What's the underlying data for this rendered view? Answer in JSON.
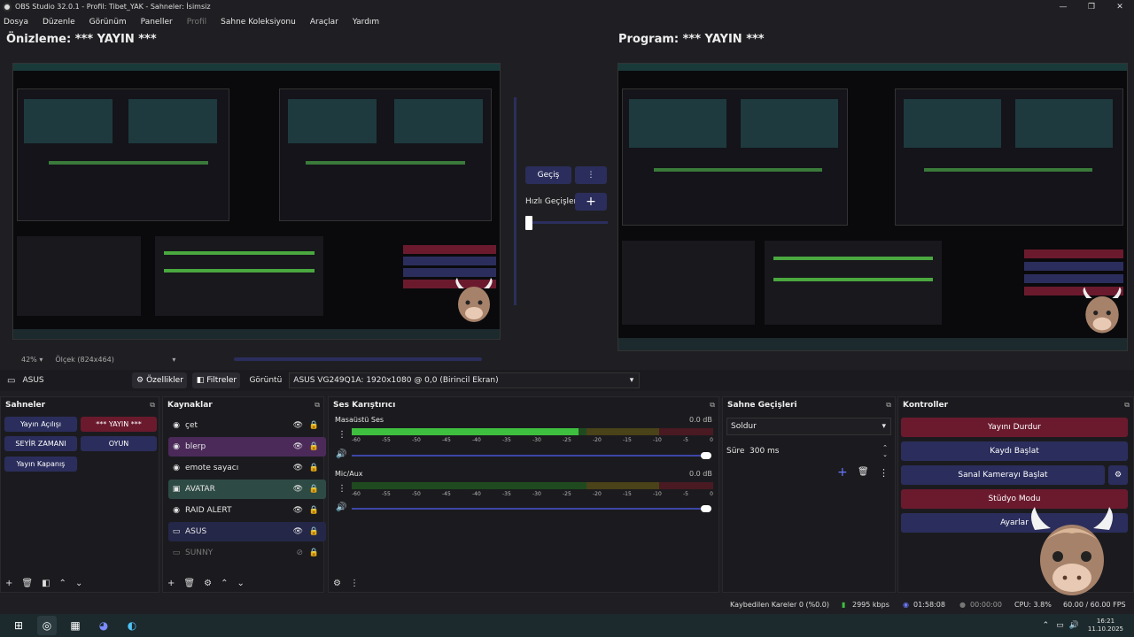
{
  "window": {
    "title": "OBS Studio 32.0.1 - Profil: Tibet_YAK - Sahneler: İsimsiz",
    "controls": [
      "—",
      "❐",
      "✕"
    ]
  },
  "menu": [
    "Dosya",
    "Düzenle",
    "Görünüm",
    "Paneller",
    "Profil",
    "Sahne Koleksiyonu",
    "Araçlar",
    "Yardım"
  ],
  "preview": {
    "title": "Önizleme: *** YAYIN ***",
    "zoom": "42%",
    "scale_label": "Ölçek (824x464)"
  },
  "program": {
    "title": "Program: *** YAYIN ***"
  },
  "transition_panel": {
    "transition_label": "Geçiş",
    "quick_label": "Hızlı Geçişler"
  },
  "context_bar": {
    "source_name": "ASUS",
    "properties_label": "Özellikler",
    "filters_label": "Filtreler",
    "display_label": "Görüntü",
    "display_value": "ASUS VG249Q1A: 1920x1080 @ 0,0 (Birincil Ekran)"
  },
  "scenes": {
    "title": "Sahneler",
    "items": [
      "Yayın Açılışı",
      "*** YAYIN ***",
      "SEYİR ZAMANI",
      "OYUN",
      "Yayın Kapanış"
    ]
  },
  "sources": {
    "title": "Kaynaklar",
    "items": [
      {
        "name": "çet",
        "icon": "globe-icon"
      },
      {
        "name": "blerp",
        "icon": "globe-icon"
      },
      {
        "name": "emote sayacı",
        "icon": "globe-icon"
      },
      {
        "name": "AVATAR",
        "icon": "image-icon"
      },
      {
        "name": "RAID ALERT",
        "icon": "globe-icon"
      },
      {
        "name": "ASUS",
        "icon": "monitor-icon"
      },
      {
        "name": "SUNNY",
        "icon": "monitor-icon"
      }
    ]
  },
  "mixer": {
    "title": "Ses Karıştırıcı",
    "ticks": [
      "-60",
      "-55",
      "-50",
      "-45",
      "-40",
      "-35",
      "-30",
      "-25",
      "-20",
      "-15",
      "-10",
      "-5",
      "0"
    ],
    "channels": [
      {
        "name": "Masaüstü Ses",
        "db": "0.0 dB",
        "level": 0.64,
        "volume": 1.0
      },
      {
        "name": "Mic/Aux",
        "db": "0.0 dB",
        "level": 0.0,
        "volume": 1.0
      }
    ]
  },
  "transitions": {
    "title": "Sahne Geçişleri",
    "selected": "Soldur",
    "duration_label": "Süre",
    "duration_value": "300 ms"
  },
  "controls": {
    "title": "Kontroller",
    "buttons": [
      "Yayını Durdur",
      "Kaydı Başlat",
      "Sanal Kamerayı Başlat",
      "Stüdyo Modu",
      "Ayarlar"
    ]
  },
  "status": {
    "dropped": "Kaybedilen Kareler 0 (%0.0)",
    "bitrate": "2995 kbps",
    "stream_time": "01:58:08",
    "rec_time": "00:00:00",
    "cpu": "CPU: 3.8%",
    "fps": "60.00 / 60.00 FPS"
  },
  "taskbar": {
    "time": "16:21",
    "date": "11.10.2025"
  },
  "colors": {
    "accent_blue": "#2b2e5c",
    "accent_red": "#6b1a2e",
    "selected_green": "#2e4a44",
    "meter_green": "#3fbf3f",
    "meter_yellow": "#b7a21b",
    "meter_red": "#b3263a"
  }
}
